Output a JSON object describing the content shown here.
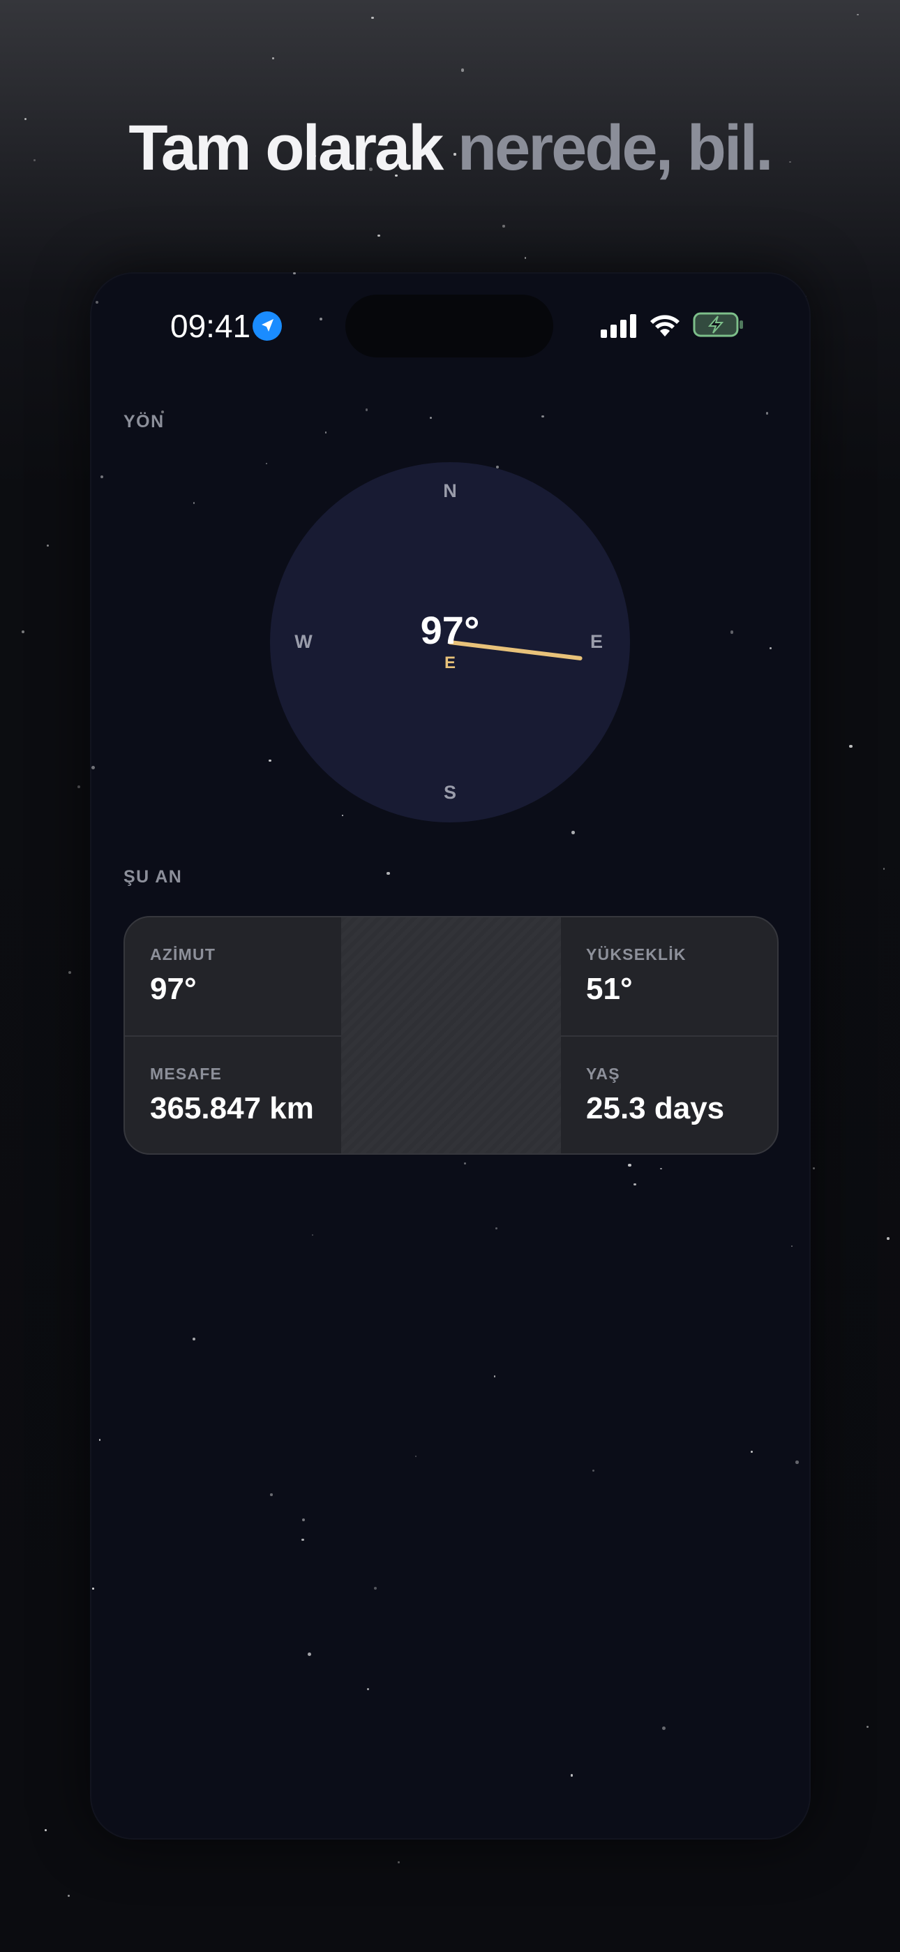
{
  "headline": {
    "part1": "Tam olarak ",
    "part2": "nerede, bil."
  },
  "status_bar": {
    "time": "09:41",
    "location_icon": "location-arrow-icon",
    "signal_icon": "cellular-signal-icon",
    "wifi_icon": "wifi-icon",
    "battery_icon": "battery-charging-icon"
  },
  "direction_section": {
    "label": "YÖN",
    "compass": {
      "north": "N",
      "south": "S",
      "east": "E",
      "west": "W",
      "value": "97°",
      "direction": "E",
      "heading_degrees": 97
    }
  },
  "now_section": {
    "label": "ŞU AN",
    "stats": [
      {
        "label": "AZİMUT",
        "value": "97°"
      },
      {
        "label": "MESAFE",
        "value": "365.847 km"
      },
      {
        "label": "YÜKSEKLİK",
        "value": "51°"
      },
      {
        "label": "YAŞ",
        "value": "25.3 days"
      }
    ]
  },
  "colors": {
    "accent_needle": "#e8c27a",
    "compass_face": "#181b33",
    "location_blue": "#1a8cff",
    "battery_green": "#7dbf8a"
  }
}
